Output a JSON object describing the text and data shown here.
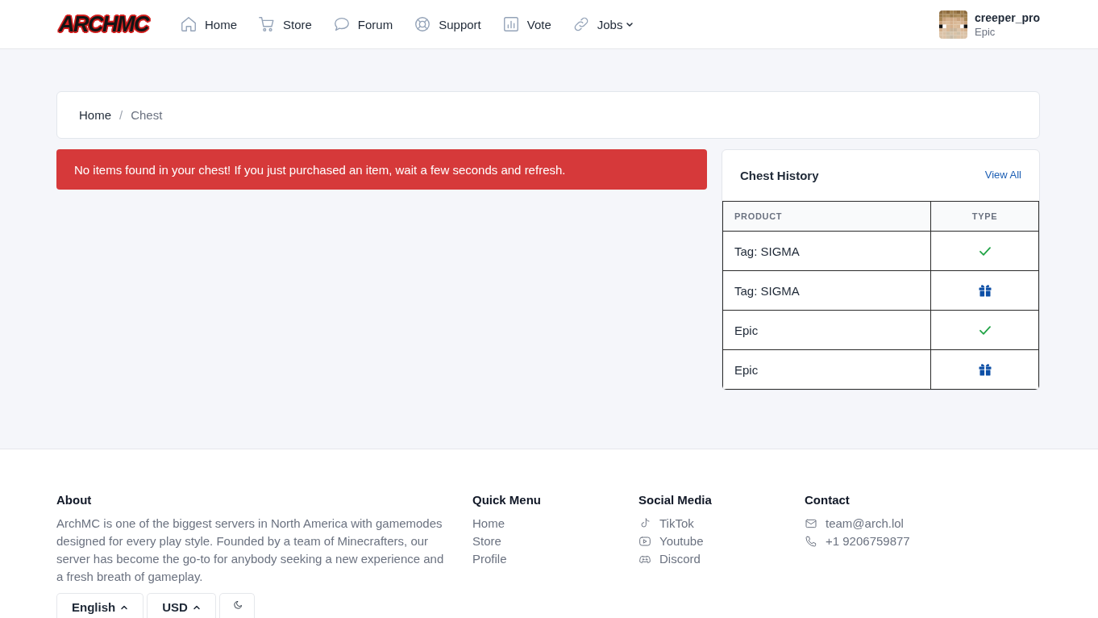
{
  "header": {
    "logo": "ARCHMC",
    "nav": [
      {
        "label": "Home",
        "dropdown": false
      },
      {
        "label": "Store",
        "dropdown": false
      },
      {
        "label": "Forum",
        "dropdown": false
      },
      {
        "label": "Support",
        "dropdown": false
      },
      {
        "label": "Vote",
        "dropdown": false
      },
      {
        "label": "Jobs",
        "dropdown": true
      }
    ],
    "user": {
      "name": "creeper_pro",
      "rank": "Epic"
    }
  },
  "breadcrumb": {
    "separator": "/",
    "items": [
      {
        "label": "Home",
        "current": false
      },
      {
        "label": "Chest",
        "current": true
      }
    ]
  },
  "alert": {
    "text": "No items found in your chest! If you just purchased an item, wait a few seconds and refresh."
  },
  "chest_history": {
    "title": "Chest History",
    "link": "View All",
    "columns": [
      "PRODUCT",
      "TYPE"
    ],
    "rows": [
      {
        "product": "Tag: SIGMA",
        "kind": "check"
      },
      {
        "product": "Tag: SIGMA",
        "kind": "gift"
      },
      {
        "product": "Epic",
        "kind": "check"
      },
      {
        "product": "Epic",
        "kind": "gift"
      }
    ]
  },
  "footer": {
    "about": {
      "title": "About",
      "text": "ArchMC is one of the biggest servers in North America with gamemodes designed for every play style. Founded by a team of Minecrafters, our server has become the go-to for anybody seeking a new experience and a fresh breath of gameplay."
    },
    "quick_menu": {
      "title": "Quick Menu",
      "links": [
        "Home",
        "Store",
        "Profile"
      ]
    },
    "social_media": {
      "title": "Social Media",
      "links": [
        "TikTok",
        "Youtube",
        "Discord"
      ]
    },
    "contact": {
      "title": "Contact",
      "items": [
        "team@arch.lol",
        "+1 9206759877"
      ]
    },
    "controls": [
      "English",
      "USD"
    ]
  }
}
